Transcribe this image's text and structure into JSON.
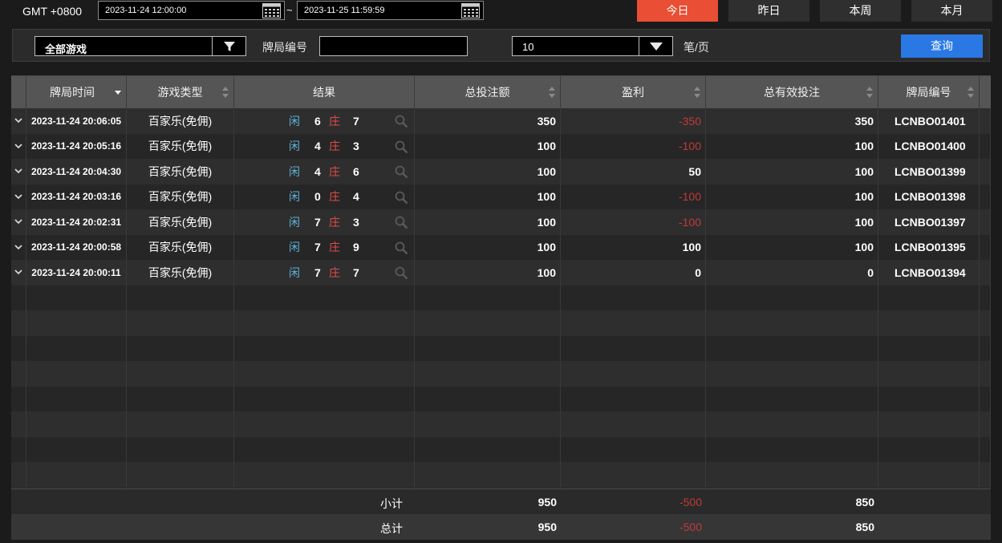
{
  "topbar": {
    "timezone": "GMT +0800",
    "start_datetime": "2023-11-24 12:00:00",
    "end_datetime": "2023-11-25 11:59:59",
    "separator": "~",
    "quick_ranges": [
      "今日",
      "昨日",
      "本周",
      "本月"
    ],
    "active_range": "今日"
  },
  "filter": {
    "game_select": "全部游戏",
    "round_no_label": "牌局编号",
    "round_no_value": "",
    "page_size": "10",
    "page_size_unit": "笔/页",
    "query_button": "查询"
  },
  "table": {
    "columns": [
      "牌局时间",
      "游戏类型",
      "结果",
      "总投注额",
      "盈利",
      "总有效投注",
      "牌局编号"
    ],
    "player_label": "闲",
    "banker_label": "庄",
    "rows": [
      {
        "time": "2023-11-24 20:06:05",
        "game": "百家乐(免佣)",
        "player": "6",
        "banker": "7",
        "bet": "350",
        "profit": "-350",
        "valid": "350",
        "round": "LCNBO01401"
      },
      {
        "time": "2023-11-24 20:05:16",
        "game": "百家乐(免佣)",
        "player": "4",
        "banker": "3",
        "bet": "100",
        "profit": "-100",
        "valid": "100",
        "round": "LCNBO01400"
      },
      {
        "time": "2023-11-24 20:04:30",
        "game": "百家乐(免佣)",
        "player": "4",
        "banker": "6",
        "bet": "100",
        "profit": "50",
        "valid": "100",
        "round": "LCNBO01399"
      },
      {
        "time": "2023-11-24 20:03:16",
        "game": "百家乐(免佣)",
        "player": "0",
        "banker": "4",
        "bet": "100",
        "profit": "-100",
        "valid": "100",
        "round": "LCNBO01398"
      },
      {
        "time": "2023-11-24 20:02:31",
        "game": "百家乐(免佣)",
        "player": "7",
        "banker": "3",
        "bet": "100",
        "profit": "-100",
        "valid": "100",
        "round": "LCNBO01397"
      },
      {
        "time": "2023-11-24 20:00:58",
        "game": "百家乐(免佣)",
        "player": "7",
        "banker": "9",
        "bet": "100",
        "profit": "100",
        "valid": "100",
        "round": "LCNBO01395"
      },
      {
        "time": "2023-11-24 20:00:11",
        "game": "百家乐(免佣)",
        "player": "7",
        "banker": "7",
        "bet": "100",
        "profit": "0",
        "valid": "0",
        "round": "LCNBO01394"
      }
    ]
  },
  "summary": {
    "subtotal_label": "小计",
    "subtotal_bet": "950",
    "subtotal_profit": "-500",
    "subtotal_valid": "850",
    "total_label": "总计",
    "total_bet": "950",
    "total_profit": "-500",
    "total_valid": "850"
  },
  "colors": {
    "active_range": "#ea4e34",
    "query_button": "#2a78e4",
    "negative": "#c2393a",
    "player": "#5fb2d8",
    "banker": "#e04b4b"
  }
}
